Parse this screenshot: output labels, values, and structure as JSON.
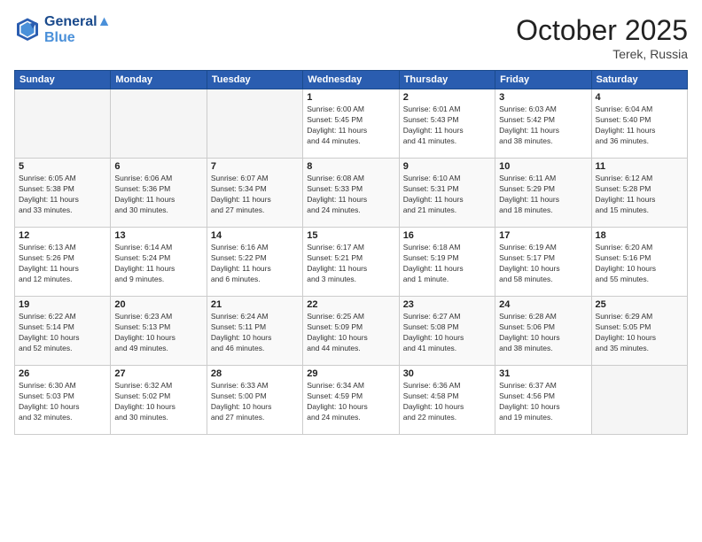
{
  "header": {
    "logo_line1": "General",
    "logo_line2": "Blue",
    "month_title": "October 2025",
    "location": "Terek, Russia"
  },
  "days_of_week": [
    "Sunday",
    "Monday",
    "Tuesday",
    "Wednesday",
    "Thursday",
    "Friday",
    "Saturday"
  ],
  "weeks": [
    [
      {
        "day": "",
        "info": ""
      },
      {
        "day": "",
        "info": ""
      },
      {
        "day": "",
        "info": ""
      },
      {
        "day": "1",
        "info": "Sunrise: 6:00 AM\nSunset: 5:45 PM\nDaylight: 11 hours\nand 44 minutes."
      },
      {
        "day": "2",
        "info": "Sunrise: 6:01 AM\nSunset: 5:43 PM\nDaylight: 11 hours\nand 41 minutes."
      },
      {
        "day": "3",
        "info": "Sunrise: 6:03 AM\nSunset: 5:42 PM\nDaylight: 11 hours\nand 38 minutes."
      },
      {
        "day": "4",
        "info": "Sunrise: 6:04 AM\nSunset: 5:40 PM\nDaylight: 11 hours\nand 36 minutes."
      }
    ],
    [
      {
        "day": "5",
        "info": "Sunrise: 6:05 AM\nSunset: 5:38 PM\nDaylight: 11 hours\nand 33 minutes."
      },
      {
        "day": "6",
        "info": "Sunrise: 6:06 AM\nSunset: 5:36 PM\nDaylight: 11 hours\nand 30 minutes."
      },
      {
        "day": "7",
        "info": "Sunrise: 6:07 AM\nSunset: 5:34 PM\nDaylight: 11 hours\nand 27 minutes."
      },
      {
        "day": "8",
        "info": "Sunrise: 6:08 AM\nSunset: 5:33 PM\nDaylight: 11 hours\nand 24 minutes."
      },
      {
        "day": "9",
        "info": "Sunrise: 6:10 AM\nSunset: 5:31 PM\nDaylight: 11 hours\nand 21 minutes."
      },
      {
        "day": "10",
        "info": "Sunrise: 6:11 AM\nSunset: 5:29 PM\nDaylight: 11 hours\nand 18 minutes."
      },
      {
        "day": "11",
        "info": "Sunrise: 6:12 AM\nSunset: 5:28 PM\nDaylight: 11 hours\nand 15 minutes."
      }
    ],
    [
      {
        "day": "12",
        "info": "Sunrise: 6:13 AM\nSunset: 5:26 PM\nDaylight: 11 hours\nand 12 minutes."
      },
      {
        "day": "13",
        "info": "Sunrise: 6:14 AM\nSunset: 5:24 PM\nDaylight: 11 hours\nand 9 minutes."
      },
      {
        "day": "14",
        "info": "Sunrise: 6:16 AM\nSunset: 5:22 PM\nDaylight: 11 hours\nand 6 minutes."
      },
      {
        "day": "15",
        "info": "Sunrise: 6:17 AM\nSunset: 5:21 PM\nDaylight: 11 hours\nand 3 minutes."
      },
      {
        "day": "16",
        "info": "Sunrise: 6:18 AM\nSunset: 5:19 PM\nDaylight: 11 hours\nand 1 minute."
      },
      {
        "day": "17",
        "info": "Sunrise: 6:19 AM\nSunset: 5:17 PM\nDaylight: 10 hours\nand 58 minutes."
      },
      {
        "day": "18",
        "info": "Sunrise: 6:20 AM\nSunset: 5:16 PM\nDaylight: 10 hours\nand 55 minutes."
      }
    ],
    [
      {
        "day": "19",
        "info": "Sunrise: 6:22 AM\nSunset: 5:14 PM\nDaylight: 10 hours\nand 52 minutes."
      },
      {
        "day": "20",
        "info": "Sunrise: 6:23 AM\nSunset: 5:13 PM\nDaylight: 10 hours\nand 49 minutes."
      },
      {
        "day": "21",
        "info": "Sunrise: 6:24 AM\nSunset: 5:11 PM\nDaylight: 10 hours\nand 46 minutes."
      },
      {
        "day": "22",
        "info": "Sunrise: 6:25 AM\nSunset: 5:09 PM\nDaylight: 10 hours\nand 44 minutes."
      },
      {
        "day": "23",
        "info": "Sunrise: 6:27 AM\nSunset: 5:08 PM\nDaylight: 10 hours\nand 41 minutes."
      },
      {
        "day": "24",
        "info": "Sunrise: 6:28 AM\nSunset: 5:06 PM\nDaylight: 10 hours\nand 38 minutes."
      },
      {
        "day": "25",
        "info": "Sunrise: 6:29 AM\nSunset: 5:05 PM\nDaylight: 10 hours\nand 35 minutes."
      }
    ],
    [
      {
        "day": "26",
        "info": "Sunrise: 6:30 AM\nSunset: 5:03 PM\nDaylight: 10 hours\nand 32 minutes."
      },
      {
        "day": "27",
        "info": "Sunrise: 6:32 AM\nSunset: 5:02 PM\nDaylight: 10 hours\nand 30 minutes."
      },
      {
        "day": "28",
        "info": "Sunrise: 6:33 AM\nSunset: 5:00 PM\nDaylight: 10 hours\nand 27 minutes."
      },
      {
        "day": "29",
        "info": "Sunrise: 6:34 AM\nSunset: 4:59 PM\nDaylight: 10 hours\nand 24 minutes."
      },
      {
        "day": "30",
        "info": "Sunrise: 6:36 AM\nSunset: 4:58 PM\nDaylight: 10 hours\nand 22 minutes."
      },
      {
        "day": "31",
        "info": "Sunrise: 6:37 AM\nSunset: 4:56 PM\nDaylight: 10 hours\nand 19 minutes."
      },
      {
        "day": "",
        "info": ""
      }
    ]
  ]
}
